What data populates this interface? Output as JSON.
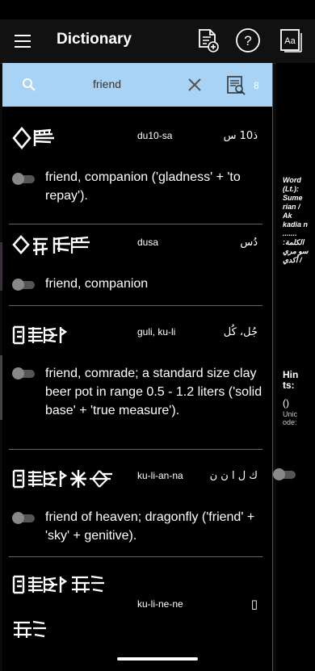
{
  "app": {
    "title": "Dictionary"
  },
  "icons": {
    "menu": "hamburger-menu-icon",
    "add_document": "add-document-icon",
    "help": "help-icon",
    "font": "font-settings-icon",
    "search": "search-icon",
    "clear": "close-icon",
    "search_results": "search-document-icon"
  },
  "search": {
    "query": "friend",
    "result_count": "8"
  },
  "entries": [
    {
      "translit": "du10-sa",
      "arabic": "ذ10 س",
      "meaning": "friend, companion ('gladness' + 'to repay')."
    },
    {
      "translit": "dusa",
      "arabic": "دُس",
      "meaning": "friend, companion"
    },
    {
      "translit": "guli, ku-li",
      "arabic": "جُل، كُل",
      "meaning": "friend, comrade; a standard size clay beer pot in range 0.5 - 1.2 liters ('solid base' + 'true measure')."
    },
    {
      "translit": "ku-li-an-na",
      "arabic": "ك ل ا ن ن",
      "meaning": "friend of heaven; dragonfly ('friend' + 'sky' + genitive)."
    },
    {
      "translit": "ku-li-ne-ne",
      "arabic": "▯",
      "meaning": ""
    }
  ],
  "side": {
    "info": "Word (Lt.): Sume rian / Ak kadia n ....... الكلمة: سو مري / أكدي",
    "hints": "Hin ts:",
    "paren": "()",
    "unicode": "Unic ode:"
  },
  "colors": {
    "search_bar": "#a9d3f5",
    "background": "#000000",
    "toggle_off": "#555555"
  }
}
